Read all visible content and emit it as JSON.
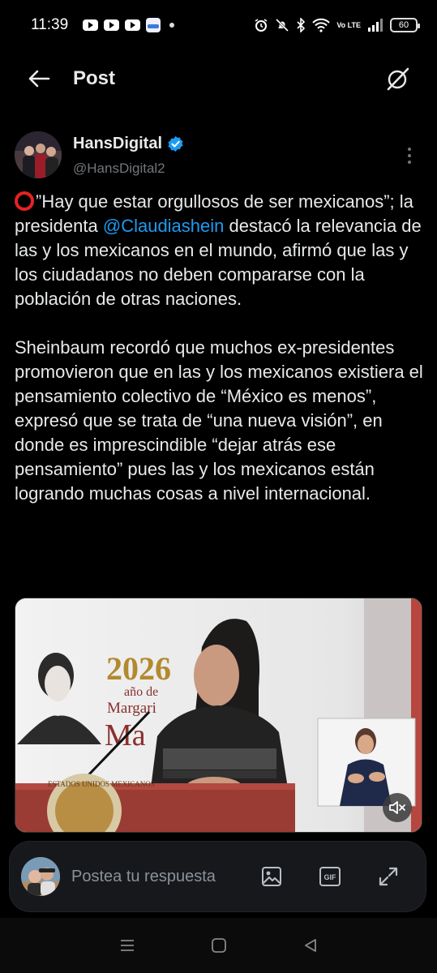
{
  "status_bar": {
    "time": "11:39",
    "network": "Vo LTE",
    "battery": "60",
    "icons": [
      "youtube-icon",
      "youtube-icon",
      "youtube-icon",
      "app-icon",
      "alarm-icon",
      "mute-icon",
      "bluetooth-icon",
      "wifi-icon",
      "signal-icon",
      "battery-icon"
    ]
  },
  "header": {
    "title": "Post",
    "back_icon": "arrow-left-icon",
    "action_icon": "grok-icon"
  },
  "author": {
    "name": "HansDigital",
    "handle": "@HansDigital2",
    "verified_color": "#1d9bf0"
  },
  "post": {
    "para1_before": "”Hay que estar orgullosos de ser mexicanos”; la presidenta ",
    "mention": "@Claudiashein",
    "para1_after": " destacó la relevancia de las y los mexicanos en el mundo, afirmó que las y los ciudadanos no deben compararse con la población de otras naciones.",
    "para2": "Sheinbaum recordó que muchos ex-presidentes promovieron que en las y los mexicanos existiera el pensamiento colectivo de “México es menos”, expresó que se trata de “una nueva visión”, en donde es imprescindible “dejar atrás ese pensamiento” pues las y los mexicanos están logrando muchas cosas a nivel internacional."
  },
  "media": {
    "banner_year": "2026",
    "banner_sub": "año de",
    "banner_name_1": "Margari",
    "banner_name_2": "Ma",
    "podium_seal": "ESTADOS UNIDOS MEXICANOS",
    "mute_icon": "volume-muted-icon"
  },
  "reply": {
    "placeholder": "Postea tu respuesta",
    "icons": [
      "image-icon",
      "gif-icon",
      "expand-icon"
    ],
    "gif_label": "GIF"
  },
  "colors": {
    "accent": "#1d9bf0",
    "background": "#000000",
    "text": "#e7e9ea",
    "muted": "#71767b"
  }
}
